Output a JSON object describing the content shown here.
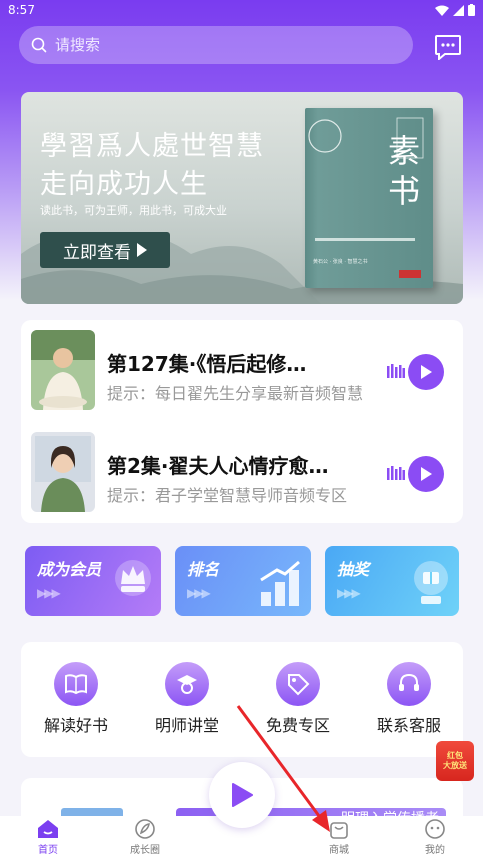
{
  "status_bar": {
    "time": "8:57"
  },
  "search": {
    "placeholder": "请搜索"
  },
  "banner": {
    "title_line1": "學習爲人處世智慧",
    "title_line2": "走向成功人生",
    "subtitle": "读此书，可为王师，用此书，可成大业",
    "button_label": "立即查看",
    "book_title": "素书",
    "book_tagline": "黄石公 · 张良 · 智慧之书"
  },
  "audio_list": [
    {
      "title": "第127集·《悟后起修…",
      "hint": "提示：每日翟先生分享最新音频智慧"
    },
    {
      "title": "第2集·翟夫人心情疗愈…",
      "hint": "提示：君子学堂智慧导师音频专区"
    }
  ],
  "promos": [
    {
      "label": "成为会员",
      "arrows": "▶▶▶"
    },
    {
      "label": "排名",
      "arrows": "▶▶▶"
    },
    {
      "label": "抽奖",
      "arrows": "▶▶▶"
    }
  ],
  "features": [
    {
      "label": "解读好书",
      "icon": "book-icon"
    },
    {
      "label": "明师讲堂",
      "icon": "teacher-icon"
    },
    {
      "label": "免费专区",
      "icon": "tag-icon"
    },
    {
      "label": "联系客服",
      "icon": "headset-icon"
    }
  ],
  "bottom_card": {
    "text": "明理入学传播者"
  },
  "redpacket": {
    "line1": "红包",
    "line2": "大放送"
  },
  "tabs": [
    {
      "label": "首页",
      "icon": "home-icon",
      "active": true
    },
    {
      "label": "成长圈",
      "icon": "growth-icon",
      "active": false
    },
    {
      "label": "商城",
      "icon": "shop-bag-icon",
      "active": false
    },
    {
      "label": "我的",
      "icon": "profile-icon",
      "active": false
    }
  ],
  "colors": {
    "brand": "#7b3ff0",
    "accent": "#8b4cf4"
  }
}
